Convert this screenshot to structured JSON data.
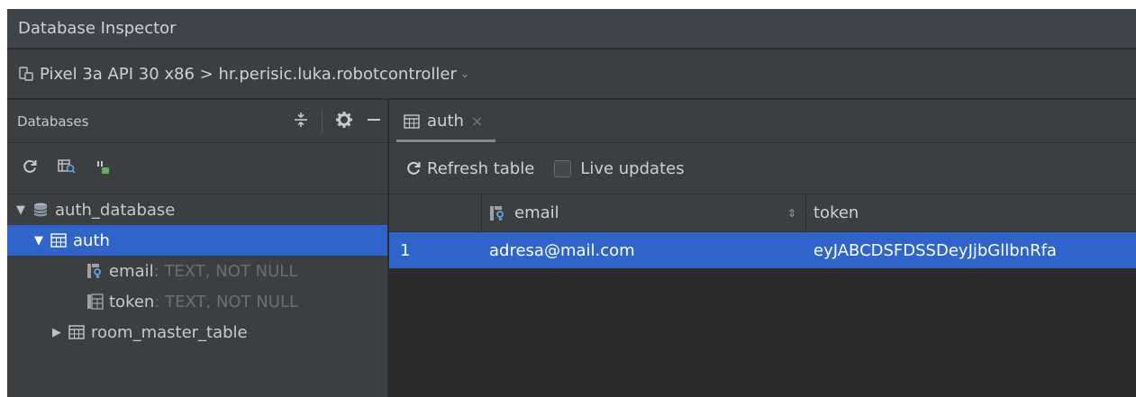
{
  "window": {
    "title": "Database Inspector",
    "device_path": "Pixel 3a API 30 x86 > hr.perisic.luka.robotcontroller"
  },
  "left_panel": {
    "header": "Databases",
    "tree": {
      "database": "auth_database",
      "tables": [
        {
          "name": "auth",
          "expanded": true,
          "selected": true,
          "columns": [
            {
              "name": "email",
              "type": " : TEXT, NOT NULL",
              "icon": "primary-key-column-icon"
            },
            {
              "name": "token",
              "type": " : TEXT, NOT NULL",
              "icon": "column-icon"
            }
          ]
        },
        {
          "name": "room_master_table",
          "expanded": false
        }
      ]
    }
  },
  "right_panel": {
    "tab": {
      "label": "auth",
      "close": "×"
    },
    "toolbar": {
      "refresh_label": "Refresh table",
      "live_updates_label": "Live updates"
    },
    "grid": {
      "columns": [
        "email",
        "token"
      ],
      "rows": [
        {
          "index": "1",
          "email": "adresa@mail.com",
          "token": "eyJABCDSFDSSDeyJjbGllbnRfa"
        }
      ]
    }
  },
  "colors": {
    "selection": "#2f65ca",
    "panel": "#3c3f41",
    "background": "#2b2b2b",
    "title_bar": "#3e434c"
  }
}
